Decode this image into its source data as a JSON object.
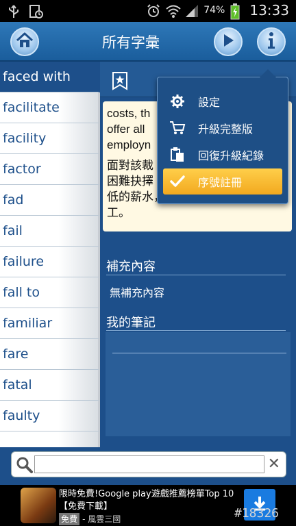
{
  "status_bar": {
    "battery_percent": "74%",
    "time": "13:33"
  },
  "header": {
    "title": "所有字彙"
  },
  "word_list": {
    "items": [
      "faced with",
      "facilitate",
      "facility",
      "factor",
      "fad",
      "fail",
      "failure",
      "fall to",
      "familiar",
      "fare",
      "fatal",
      "faulty"
    ],
    "selected_index": 0
  },
  "entry": {
    "english_lines": [
      "costs, th",
      "offer all",
      "employn"
    ],
    "chinese_lines": [
      "面對該裁",
      "困難抉擇",
      "低的薪水，繼續雇用所有員",
      "工。"
    ]
  },
  "sections": {
    "supplement_title": "補充內容",
    "supplement_empty": "無補充內容",
    "notes_title": "我的筆記"
  },
  "menu": {
    "items": [
      {
        "label": "設定",
        "icon": "gear-icon"
      },
      {
        "label": "升級完整版",
        "icon": "cart-icon"
      },
      {
        "label": "回復升級紀錄",
        "icon": "clipboard-icon"
      },
      {
        "label": "序號註冊",
        "icon": "checkmark-icon"
      }
    ],
    "active_index": 3
  },
  "search": {
    "value": "",
    "clear_label": "✕"
  },
  "ad": {
    "headline": "限時免費!Google play遊戲推薦榜單Top 10【免費下載】",
    "free_badge": "免費",
    "publisher": "- 風雲三國",
    "tag": "#18326"
  },
  "colors": {
    "header_blue": "#1a5d9c",
    "content_blue": "#1d4f8a",
    "highlight_orange": "#f2a91f",
    "card_background": "#fff9e3"
  }
}
